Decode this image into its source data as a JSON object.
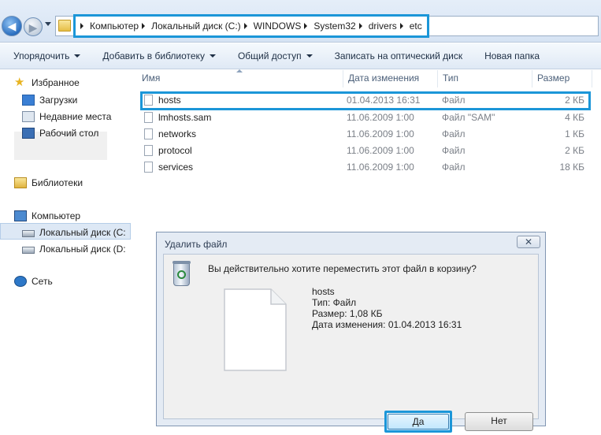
{
  "address_bar": {
    "breadcrumbs": [
      "Компьютер",
      "Локальный диск (C:)",
      "WINDOWS",
      "System32",
      "drivers",
      "etc"
    ]
  },
  "toolbar": {
    "organize": "Упорядочить",
    "add_library": "Добавить в библиотеку",
    "share": "Общий доступ",
    "burn": "Записать на оптический диск",
    "new_folder": "Новая папка"
  },
  "nav": {
    "favorites": "Избранное",
    "downloads": "Загрузки",
    "recent": "Недавние места",
    "desktop": "Рабочий стол",
    "libraries": "Библиотеки",
    "computer": "Компьютер",
    "disk_c": "Локальный диск (C:",
    "disk_d": "Локальный диск (D:",
    "network": "Сеть"
  },
  "columns": {
    "name": "Имя",
    "date": "Дата изменения",
    "type": "Тип",
    "size": "Размер"
  },
  "files": [
    {
      "name": "hosts",
      "date": "01.04.2013 16:31",
      "type": "Файл",
      "size": "2 КБ"
    },
    {
      "name": "lmhosts.sam",
      "date": "11.06.2009 1:00",
      "type": "Файл \"SAM\"",
      "size": "4 КБ"
    },
    {
      "name": "networks",
      "date": "11.06.2009 1:00",
      "type": "Файл",
      "size": "1 КБ"
    },
    {
      "name": "protocol",
      "date": "11.06.2009 1:00",
      "type": "Файл",
      "size": "2 КБ"
    },
    {
      "name": "services",
      "date": "11.06.2009 1:00",
      "type": "Файл",
      "size": "18 КБ"
    }
  ],
  "dialog": {
    "title": "Удалить файл",
    "close": "✕",
    "question": "Вы действительно хотите переместить этот файл в корзину?",
    "file_name": "hosts",
    "file_type": "Тип: Файл",
    "file_size": "Размер: 1,08 КБ",
    "file_date": "Дата изменения: 01.04.2013 16:31",
    "yes": "Да",
    "no": "Нет"
  },
  "colors": {
    "highlight": "#1b96d8"
  }
}
